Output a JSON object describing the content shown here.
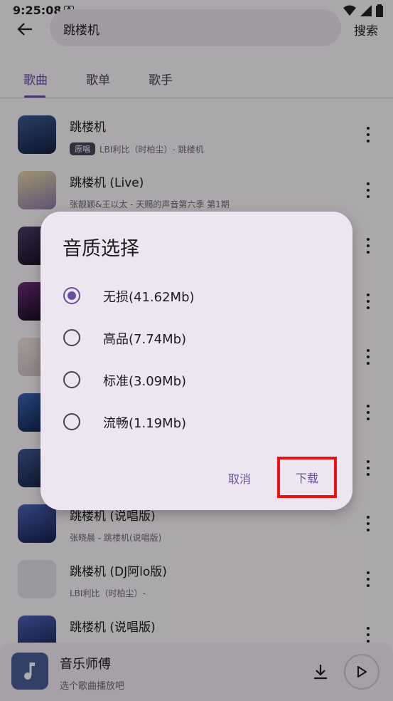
{
  "status_bar": {
    "time": "9:25:08",
    "notification_letter": "A"
  },
  "top_bar": {
    "query": "跳楼机",
    "search_label": "搜索"
  },
  "tabs": [
    {
      "label": "歌曲",
      "active": true
    },
    {
      "label": "歌单",
      "active": false
    },
    {
      "label": "歌手",
      "active": false
    }
  ],
  "songs": [
    {
      "title": "跳楼机",
      "badge": "原唱",
      "subtitle": "LBI利比（时柏尘）- 跳楼机",
      "cover_color": "#2a3f6b"
    },
    {
      "title": "跳楼机 (Live)",
      "badge": "",
      "subtitle": "张靓颖&王以太 - 天赐的声音第六季 第1期",
      "cover_color": "#c9b48f"
    },
    {
      "title": "",
      "badge": "",
      "subtitle": "",
      "cover_color": "#2b2340"
    },
    {
      "title": "",
      "badge": "",
      "subtitle": "",
      "cover_color": "#231a2e"
    },
    {
      "title": "",
      "badge": "",
      "subtitle": "",
      "cover_color": "#e6d6d6"
    },
    {
      "title": "",
      "badge": "",
      "subtitle": "",
      "cover_color": "#24407a"
    },
    {
      "title": "",
      "badge": "",
      "subtitle": "",
      "cover_color": "#1f3564"
    },
    {
      "title": "跳楼机 (说唱版)",
      "badge": "",
      "subtitle": "张晓晨 - 跳楼机(说唱版)",
      "cover_color": "#2c3a70"
    },
    {
      "title": "跳楼机 (DJ阿lo版)",
      "badge": "",
      "subtitle": "LBI利比（时柏尘）-",
      "cover_color": "#e4dfe8"
    },
    {
      "title": "跳楼机 (说唱版)",
      "badge": "",
      "subtitle": "",
      "cover_color": "#2c3a70"
    }
  ],
  "player": {
    "title": "音乐师傅",
    "subtitle": "选个歌曲播放吧"
  },
  "dialog": {
    "title": "音质选择",
    "options": [
      {
        "label": "无损(41.62Mb)",
        "selected": true
      },
      {
        "label": "高品(7.74Mb)",
        "selected": false
      },
      {
        "label": "标准(3.09Mb)",
        "selected": false
      },
      {
        "label": "流畅(1.19Mb)",
        "selected": false
      }
    ],
    "cancel_label": "取消",
    "download_label": "下载"
  },
  "colors": {
    "accent": "#6750a4",
    "highlight_box": "#ee1111"
  }
}
